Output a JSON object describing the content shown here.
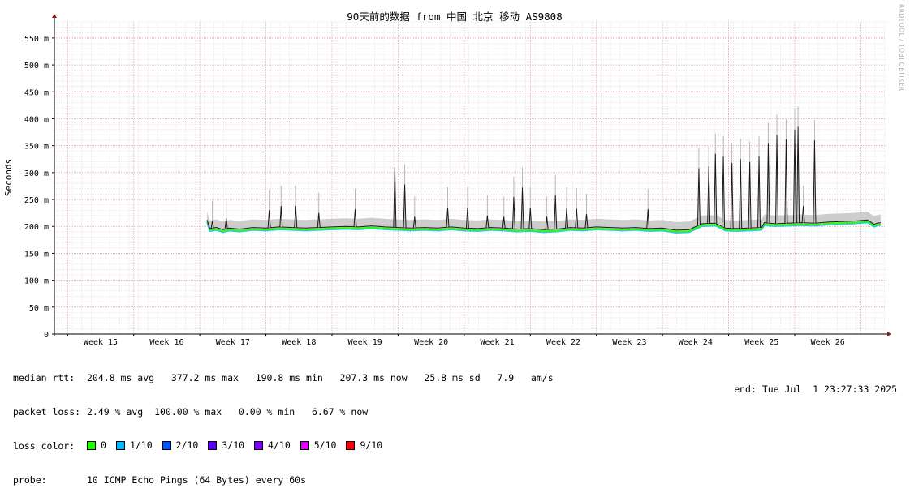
{
  "chart_data": {
    "type": "line",
    "title": "90天前的数据 from 中国 北京 移动 AS9808",
    "ylabel": "Seconds",
    "xlabel": "",
    "ylim": [
      0,
      580
    ],
    "y_ticks": [
      {
        "value": 0,
        "label": "0"
      },
      {
        "value": 50,
        "label": "50 m"
      },
      {
        "value": 100,
        "label": "100 m"
      },
      {
        "value": 150,
        "label": "150 m"
      },
      {
        "value": 200,
        "label": "200 m"
      },
      {
        "value": 250,
        "label": "250 m"
      },
      {
        "value": 300,
        "label": "300 m"
      },
      {
        "value": 350,
        "label": "350 m"
      },
      {
        "value": 400,
        "label": "400 m"
      },
      {
        "value": 450,
        "label": "450 m"
      },
      {
        "value": 500,
        "label": "500 m"
      },
      {
        "value": 550,
        "label": "550 m"
      }
    ],
    "x_range_weeks": [
      14.3,
      26.9
    ],
    "x_ticks": [
      {
        "week": 15,
        "label": "Week 15"
      },
      {
        "week": 16,
        "label": "Week 16"
      },
      {
        "week": 17,
        "label": "Week 17"
      },
      {
        "week": 18,
        "label": "Week 18"
      },
      {
        "week": 19,
        "label": "Week 19"
      },
      {
        "week": 20,
        "label": "Week 20"
      },
      {
        "week": 21,
        "label": "Week 21"
      },
      {
        "week": 22,
        "label": "Week 22"
      },
      {
        "week": 23,
        "label": "Week 23"
      },
      {
        "week": 24,
        "label": "Week 24"
      },
      {
        "week": 25,
        "label": "Week 25"
      },
      {
        "week": 26,
        "label": "Week 26"
      }
    ],
    "grid": true,
    "series": [
      {
        "color": "#1a1a1a",
        "x": [
          16.61,
          16.65,
          16.75,
          16.85,
          16.95,
          17.1,
          17.3,
          17.5,
          17.7,
          17.9,
          18.1,
          18.3,
          18.5,
          18.7,
          18.9,
          19.1,
          19.3,
          19.5,
          19.7,
          19.9,
          20.1,
          20.3,
          20.5,
          20.7,
          20.9,
          21.1,
          21.3,
          21.5,
          21.7,
          21.9,
          22.1,
          22.3,
          22.5,
          22.7,
          22.9,
          23.1,
          23.3,
          23.5,
          23.7,
          23.9,
          24.1,
          24.3,
          24.45,
          24.6,
          24.8,
          25.0,
          25.04,
          25.2,
          25.4,
          25.6,
          25.8,
          26.0,
          26.2,
          26.4,
          26.6,
          26.7,
          26.75,
          26.8
        ],
        "values": [
          212,
          196,
          198,
          194,
          197,
          195,
          198,
          197,
          199,
          198,
          197,
          198,
          199,
          200,
          199,
          201,
          199,
          198,
          197,
          198,
          197,
          199,
          197,
          196,
          198,
          197,
          195,
          196,
          194,
          195,
          198,
          197,
          199,
          198,
          197,
          198,
          196,
          197,
          193,
          194,
          205,
          206,
          197,
          196,
          197,
          198,
          207,
          205,
          206,
          207,
          206,
          208,
          209,
          210,
          212,
          204,
          206,
          207
        ]
      }
    ],
    "spikes": [
      {
        "week": 16.69,
        "value": 210
      },
      {
        "week": 16.9,
        "value": 215
      },
      {
        "week": 17.55,
        "value": 230
      },
      {
        "week": 17.73,
        "value": 238
      },
      {
        "week": 17.95,
        "value": 238
      },
      {
        "week": 18.3,
        "value": 225
      },
      {
        "week": 18.85,
        "value": 232
      },
      {
        "week": 19.45,
        "value": 310
      },
      {
        "week": 19.6,
        "value": 278
      },
      {
        "week": 19.75,
        "value": 218
      },
      {
        "week": 20.25,
        "value": 235
      },
      {
        "week": 20.55,
        "value": 235
      },
      {
        "week": 20.85,
        "value": 220
      },
      {
        "week": 21.1,
        "value": 218
      },
      {
        "week": 21.25,
        "value": 255
      },
      {
        "week": 21.38,
        "value": 272
      },
      {
        "week": 21.5,
        "value": 235
      },
      {
        "week": 21.75,
        "value": 218
      },
      {
        "week": 21.88,
        "value": 258
      },
      {
        "week": 22.05,
        "value": 235
      },
      {
        "week": 22.2,
        "value": 233
      },
      {
        "week": 22.35,
        "value": 223
      },
      {
        "week": 23.28,
        "value": 232
      },
      {
        "week": 24.05,
        "value": 308
      },
      {
        "week": 24.2,
        "value": 312
      },
      {
        "week": 24.3,
        "value": 335
      },
      {
        "week": 24.42,
        "value": 330
      },
      {
        "week": 24.55,
        "value": 318
      },
      {
        "week": 24.68,
        "value": 325
      },
      {
        "week": 24.82,
        "value": 320
      },
      {
        "week": 24.96,
        "value": 330
      },
      {
        "week": 25.1,
        "value": 355
      },
      {
        "week": 25.23,
        "value": 370
      },
      {
        "week": 25.37,
        "value": 362
      },
      {
        "week": 25.5,
        "value": 380
      },
      {
        "week": 25.55,
        "value": 385
      },
      {
        "week": 25.63,
        "value": 238
      },
      {
        "week": 25.8,
        "value": 360
      }
    ]
  },
  "legend": {
    "median_rtt": {
      "key": "median rtt:",
      "value": "204.8 ms avg   377.2 ms max   190.8 ms min   207.3 ms now   25.8 ms sd   7.9   am/s"
    },
    "packet_loss": {
      "key": "packet loss:",
      "value": "2.49 % avg  100.00 % max   0.00 % min   6.67 % now"
    },
    "loss_color": {
      "key": "loss color:",
      "items": [
        {
          "label": "0",
          "color": "#26ff00"
        },
        {
          "label": "1/10",
          "color": "#00b8ff"
        },
        {
          "label": "2/10",
          "color": "#0059ff"
        },
        {
          "label": "3/10",
          "color": "#5e00ff"
        },
        {
          "label": "4/10",
          "color": "#7e00ff"
        },
        {
          "label": "5/10",
          "color": "#dd00ff"
        },
        {
          "label": "9/10",
          "color": "#ff0000"
        }
      ]
    },
    "probe": {
      "key": "probe:",
      "value": "10 ICMP Echo Pings (64 Bytes) every 60s"
    }
  },
  "end_time": "end: Tue Jul  1 23:27:33 2025",
  "watermark": "RRDTOOL / TOBI OETIKER"
}
